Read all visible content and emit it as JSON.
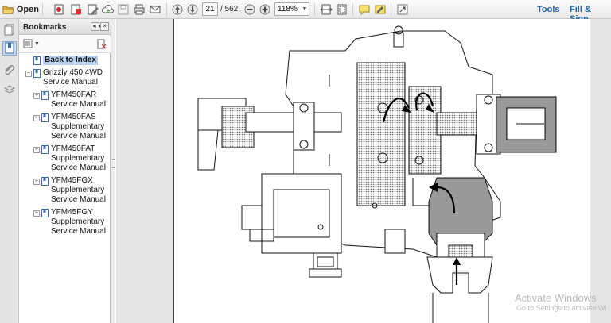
{
  "toolbar": {
    "open_label": "Open",
    "current_page": "21",
    "total_pages": "/ 562",
    "zoom": "118%",
    "tools_label": "Tools",
    "fill_sign_label": "Fill & Sign",
    "link_color": "#1a63a8"
  },
  "bookmarks": {
    "title": "Bookmarks",
    "items": [
      {
        "label": "Back to Index",
        "selected": true
      },
      {
        "label": "Grizzly 450 4WD\nService Manual"
      },
      {
        "label": "YFM450FAR\nService Manual"
      },
      {
        "label": "YFM450FAS\nSupplementary\nService Manual"
      },
      {
        "label": "YFM450FAT\nSupplementary\nService Manual"
      },
      {
        "label": "YFM45FGX\nSupplementary\nService Manual"
      },
      {
        "label": "YFM45FGY\nSupplementary\nService Manual"
      }
    ]
  },
  "watermark": {
    "line1": "Activate Windows",
    "line2": "Go to Settings to activate Wi"
  }
}
